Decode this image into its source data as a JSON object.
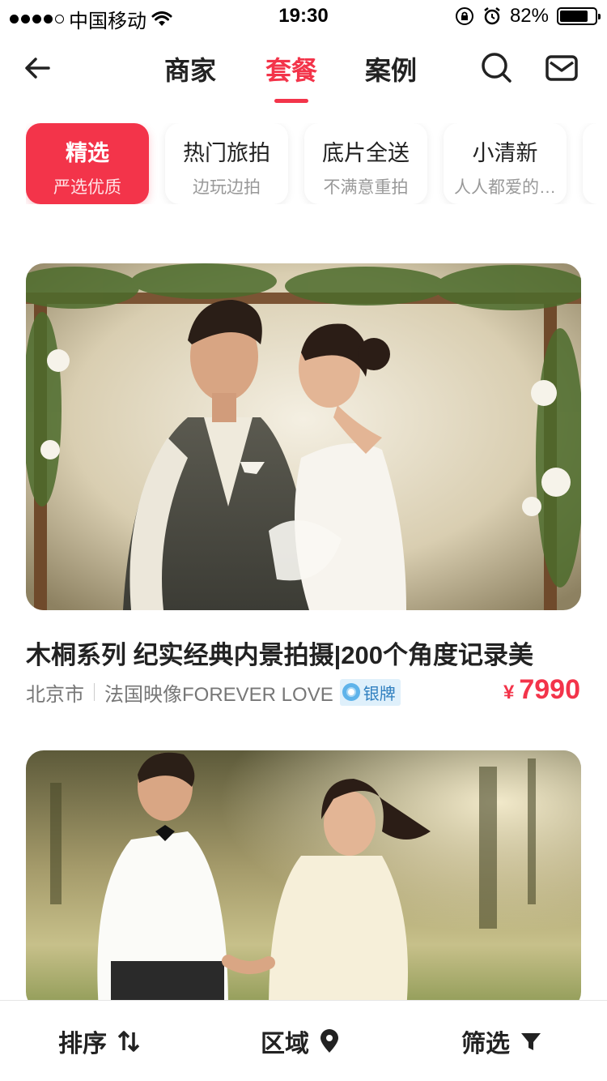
{
  "status_bar": {
    "carrier": "中国移动",
    "time": "19:30",
    "battery": "82%",
    "battery_level": 0.82
  },
  "nav": {
    "tabs": [
      {
        "label": "商家",
        "active": false
      },
      {
        "label": "套餐",
        "active": true
      },
      {
        "label": "案例",
        "active": false
      }
    ]
  },
  "chips": [
    {
      "title": "精选",
      "subtitle": "严选优质",
      "active": true
    },
    {
      "title": "热门旅拍",
      "subtitle": "边玩边拍",
      "active": false
    },
    {
      "title": "底片全送",
      "subtitle": "不满意重拍",
      "active": false
    },
    {
      "title": "小清新",
      "subtitle": "人人都爱的…",
      "active": false
    }
  ],
  "cards": [
    {
      "title": "木桐系列 纪实经典内景拍摄|200个角度记录美",
      "city": "北京市",
      "merchant": "法国映像FOREVER LOVE",
      "badge": "银牌",
      "currency": "¥",
      "price": "7990"
    }
  ],
  "bottom_bar": {
    "sort": "排序",
    "area": "区域",
    "filter": "筛选"
  },
  "colors": {
    "accent": "#f3344a",
    "badge_bg": "#dff0fb",
    "badge_text": "#2f7fbf"
  },
  "icons": [
    "back-arrow-icon",
    "search-icon",
    "mail-icon",
    "sort-icon",
    "location-pin-icon",
    "filter-icon",
    "wifi-icon",
    "lock-rotation-icon",
    "alarm-icon",
    "battery-icon",
    "silver-medal-icon"
  ]
}
